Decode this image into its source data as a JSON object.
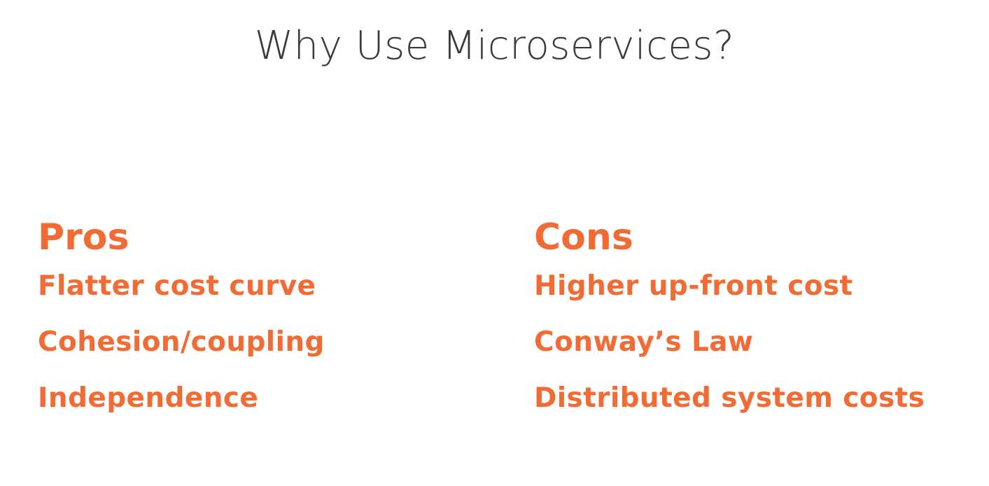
{
  "slide": {
    "title": "Why Use Microservices?",
    "accent_color": "#f26b34",
    "title_color": "#3a3a3a",
    "pros": {
      "heading": "Pros",
      "items": [
        "Flatter cost curve",
        "Cohesion/coupling",
        "Independence"
      ]
    },
    "cons": {
      "heading": "Cons",
      "items": [
        "Higher up-front cost",
        "Conway’s Law",
        "Distributed system costs"
      ]
    }
  }
}
